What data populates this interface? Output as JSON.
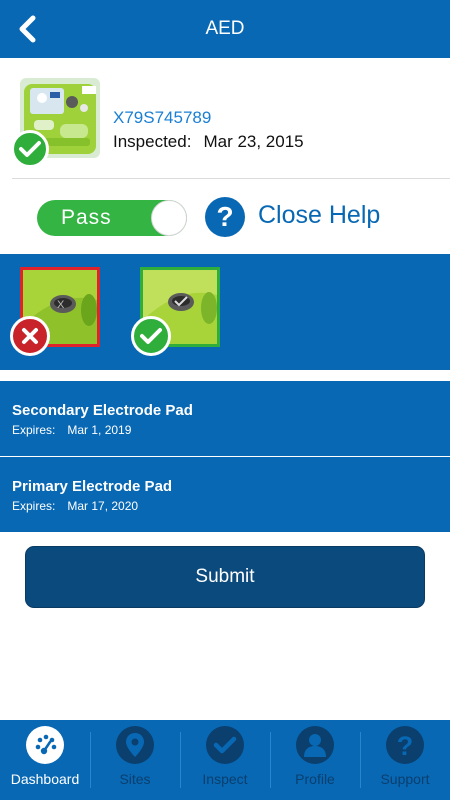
{
  "header": {
    "title": "AED",
    "back_icon": "chevron-left-icon"
  },
  "device": {
    "serial": "X79S745789",
    "inspected_label": "Inspected:",
    "inspected_date": "Mar 23, 2015",
    "status_icon": "check-icon"
  },
  "status": {
    "toggle_label": "Pass",
    "help_label": "Close Help",
    "help_icon": "question-icon"
  },
  "help_examples": [
    {
      "status_icon": "x-icon"
    },
    {
      "status_icon": "check-icon"
    }
  ],
  "pads": [
    {
      "title": "Secondary Electrode Pad",
      "expires_label": "Expires:",
      "expires_date": "Mar 1, 2019"
    },
    {
      "title": "Primary Electrode Pad",
      "expires_label": "Expires:",
      "expires_date": "Mar 17, 2020"
    }
  ],
  "submit_label": "Submit",
  "tabs": [
    {
      "label": "Dashboard",
      "icon": "dashboard-gauge-icon",
      "active": true
    },
    {
      "label": "Sites",
      "icon": "location-pin-icon",
      "active": false
    },
    {
      "label": "Inspect",
      "icon": "check-icon",
      "active": false
    },
    {
      "label": "Profile",
      "icon": "person-icon",
      "active": false
    },
    {
      "label": "Support",
      "icon": "question-icon",
      "active": false
    }
  ],
  "colors": {
    "brand_blue": "#0868b4",
    "dark_blue": "#0b4a7c",
    "pass_green": "#2fae3c",
    "fail_red": "#c8232a",
    "link_blue": "#1a7fd4"
  }
}
